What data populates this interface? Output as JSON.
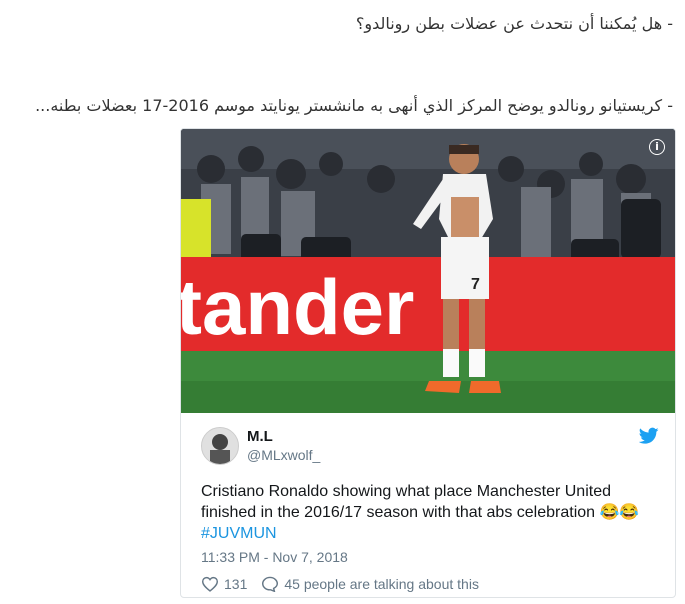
{
  "article": {
    "line1": "- هل يُمكننا أن نتحدث عن عضلات بطن رونالدو؟",
    "line2": "- كريستيانو رونالدو يوضح المركز الذي أنهى به مانشستر يونايتد موسم 2016-17 بعضلات بطنه..."
  },
  "tweet": {
    "media_banner_text": "tander",
    "jersey_number": "7",
    "author_name": "M.L",
    "author_handle": "@MLxwolf_",
    "text_line1": "Cristiano Ronaldo showing what place Manchester United",
    "text_line2": "finished in the 2016/17 season with that abs celebration 😂😂",
    "hashtag": "#JUVMUN",
    "timestamp": "11:33 PM - Nov 7, 2018",
    "like_count": "131",
    "talking_text": "45 people are talking about this",
    "info_icon_glyph": "i"
  },
  "colors": {
    "twitter_blue": "#1da1f2",
    "hashtag_blue": "#1b95e0",
    "muted_text": "#657786",
    "ad_board_red": "#e32b2b"
  }
}
